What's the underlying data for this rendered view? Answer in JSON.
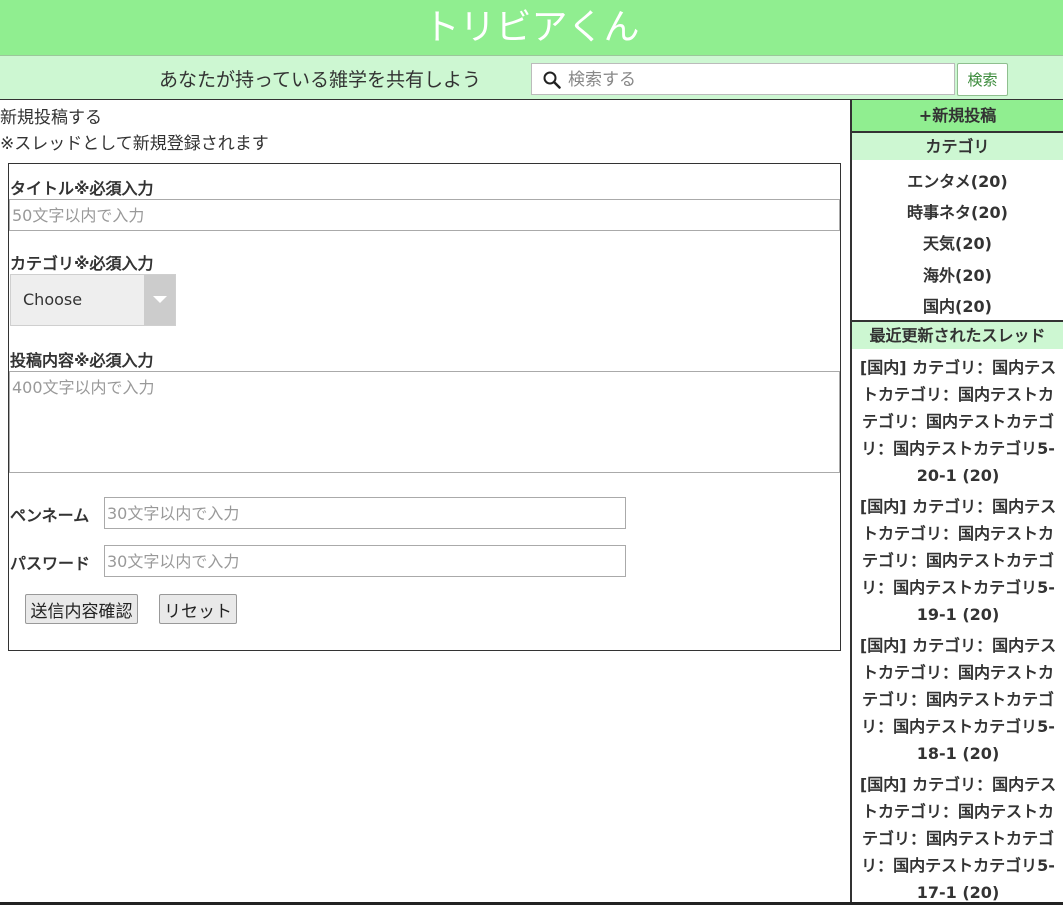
{
  "header": {
    "title": "トリビアくん"
  },
  "subbar": {
    "tagline": "あなたが持っている雑学を共有しよう",
    "search_placeholder": "検索する",
    "search_button": "検索"
  },
  "main": {
    "heading": "新規投稿する",
    "note": "※スレッドとして新規登録されます",
    "form": {
      "title_label": "タイトル※必須入力",
      "title_placeholder": "50文字以内で入力",
      "category_label": "カテゴリ※必須入力",
      "category_selected": "Choose",
      "content_label": "投稿内容※必須入力",
      "content_placeholder": "400文字以内で入力",
      "penname_label": "ペンネーム",
      "penname_placeholder": "30文字以内で入力",
      "password_label": "パスワード",
      "password_placeholder": "30文字以内で入力",
      "confirm_button": "送信内容確認",
      "reset_button": "リセット"
    }
  },
  "sidebar": {
    "new_post": "+新規投稿",
    "category_heading": "カテゴリ",
    "categories": [
      "エンタメ(20)",
      "時事ネタ(20)",
      "天気(20)",
      "海外(20)",
      "国内(20)"
    ],
    "recent_heading": "最近更新されたスレッド",
    "threads": [
      "[国内] カテゴリ：国内テストカテゴリ：国内テストカテゴリ：国内テストカテゴリ：国内テストカテゴリ5-20-1 (20)",
      "[国内] カテゴリ：国内テストカテゴリ：国内テストカテゴリ：国内テストカテゴリ：国内テストカテゴリ5-19-1 (20)",
      "[国内] カテゴリ：国内テストカテゴリ：国内テストカテゴリ：国内テストカテゴリ：国内テストカテゴリ5-18-1 (20)",
      "[国内] カテゴリ：国内テストカテゴリ：国内テストカテゴリ：国内テストカテゴリ：国内テストカテゴリ5-17-1 (20)"
    ]
  }
}
